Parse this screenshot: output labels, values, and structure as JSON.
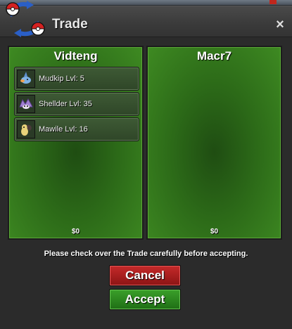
{
  "window": {
    "title": "Trade",
    "close_label": "×"
  },
  "left_panel": {
    "player": "Vidteng",
    "money": "$0",
    "items": [
      {
        "label": "Mudkip  Lvl: 5",
        "icon": "mudkip-sprite-icon"
      },
      {
        "label": "Shellder  Lvl: 35",
        "icon": "shellder-sprite-icon"
      },
      {
        "label": "Mawile  Lvl: 16",
        "icon": "mawile-sprite-icon"
      }
    ]
  },
  "right_panel": {
    "player": "Macr7",
    "money": "$0",
    "items": []
  },
  "notice": "Please check over the Trade carefully before accepting.",
  "buttons": {
    "cancel": "Cancel",
    "accept": "Accept"
  },
  "colors": {
    "panel_green": "#2c6a18",
    "cancel_red": "#c52a2a",
    "accept_green": "#3aa02a"
  }
}
